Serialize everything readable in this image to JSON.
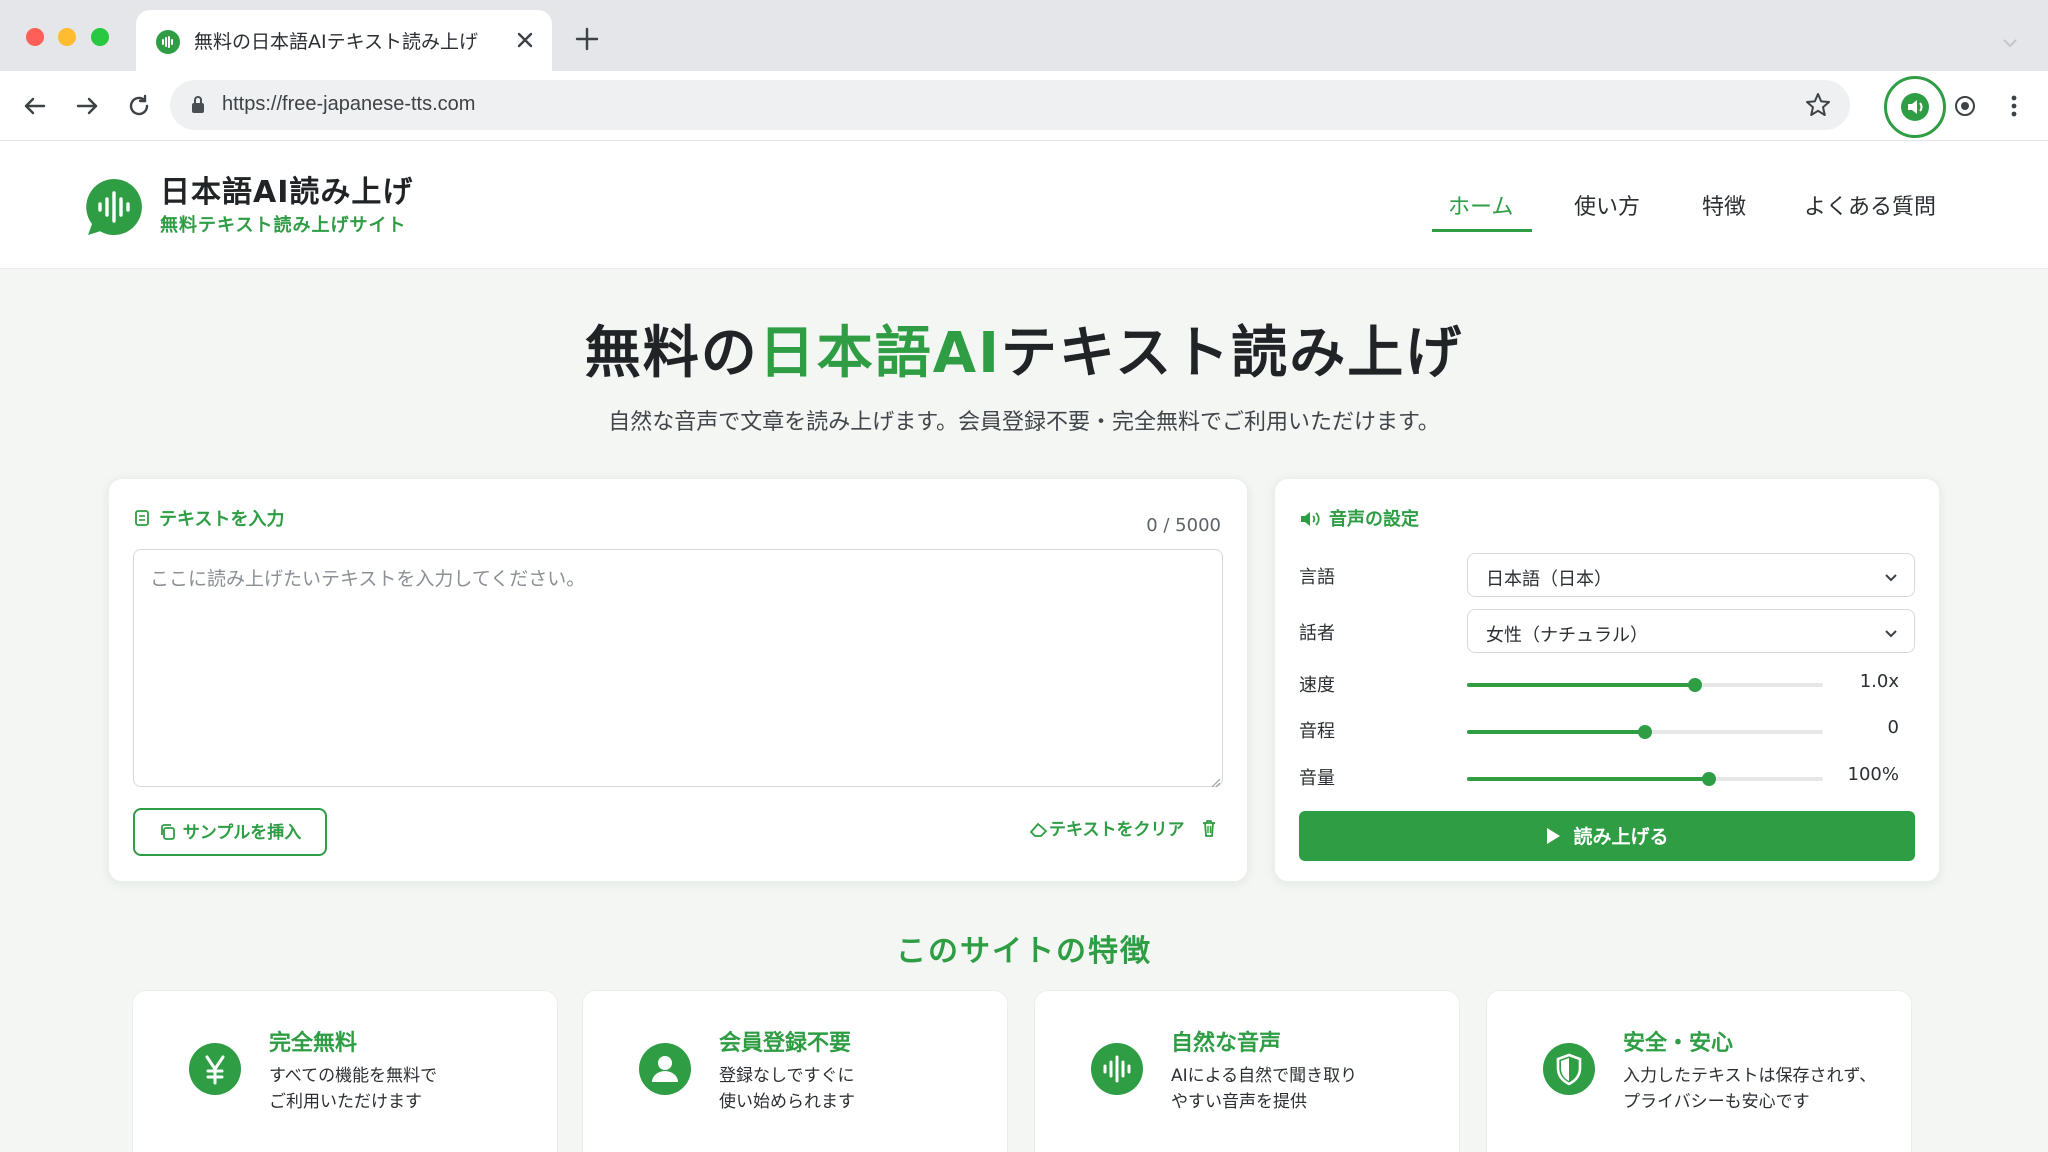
{
  "browser": {
    "tab_title": "無料の日本語AIテキスト読み上げ",
    "url": "https://free-japanese-tts.com"
  },
  "header": {
    "logo_title": "日本語AI読み上げ",
    "logo_subtitle": "無料テキスト読み上げサイト",
    "nav": [
      "ホーム",
      "使い方",
      "特徴",
      "よくある質問"
    ],
    "active_nav": "ホーム"
  },
  "hero": {
    "title_prefix": "無料の",
    "title_accent": "日本語AI",
    "title_suffix": "テキスト読み上げ",
    "subtitle": "自然な音声で文章を読み上げます。会員登録不要・完全無料でご利用いただけます。"
  },
  "input_panel": {
    "title": "テキストを入力",
    "counter": "0 / 5000",
    "placeholder": "ここに読み上げたいテキストを入力してください。",
    "sample_button": "サンプルを挿入",
    "clear_button": "テキストをクリア"
  },
  "voice_panel": {
    "title": "音声の設定",
    "language_label": "言語",
    "language_value": "日本語（日本）",
    "speaker_label": "話者",
    "speaker_value": "女性（ナチュラル）",
    "speed": {
      "label": "速度",
      "display": "1.0x",
      "fill_fraction": 0.64
    },
    "pitch": {
      "label": "音程",
      "display": "0",
      "fill_fraction": 0.5
    },
    "volume": {
      "label": "音量",
      "display": "100%",
      "fill_fraction": 0.68
    },
    "read_button": "読み上げる"
  },
  "features": {
    "title": "このサイトの特徴",
    "items": [
      {
        "icon": "yen-icon",
        "title": "完全無料",
        "desc1": "すべての機能を無料で",
        "desc2": "ご利用いただけます"
      },
      {
        "icon": "user-icon",
        "title": "会員登録不要",
        "desc1": "登録なしですぐに",
        "desc2": "使い始められます"
      },
      {
        "icon": "waveform-icon",
        "title": "自然な音声",
        "desc1": "AIによる自然で聞き取り",
        "desc2": "やすい音声を提供"
      },
      {
        "icon": "shield-icon",
        "title": "安全・安心",
        "desc1": "入力したテキストは保存されず、",
        "desc2": "プライバシーも安心です"
      }
    ]
  },
  "colors": {
    "accent": "#2e9d44",
    "text": "#202427",
    "background": "#f3f6f3"
  }
}
